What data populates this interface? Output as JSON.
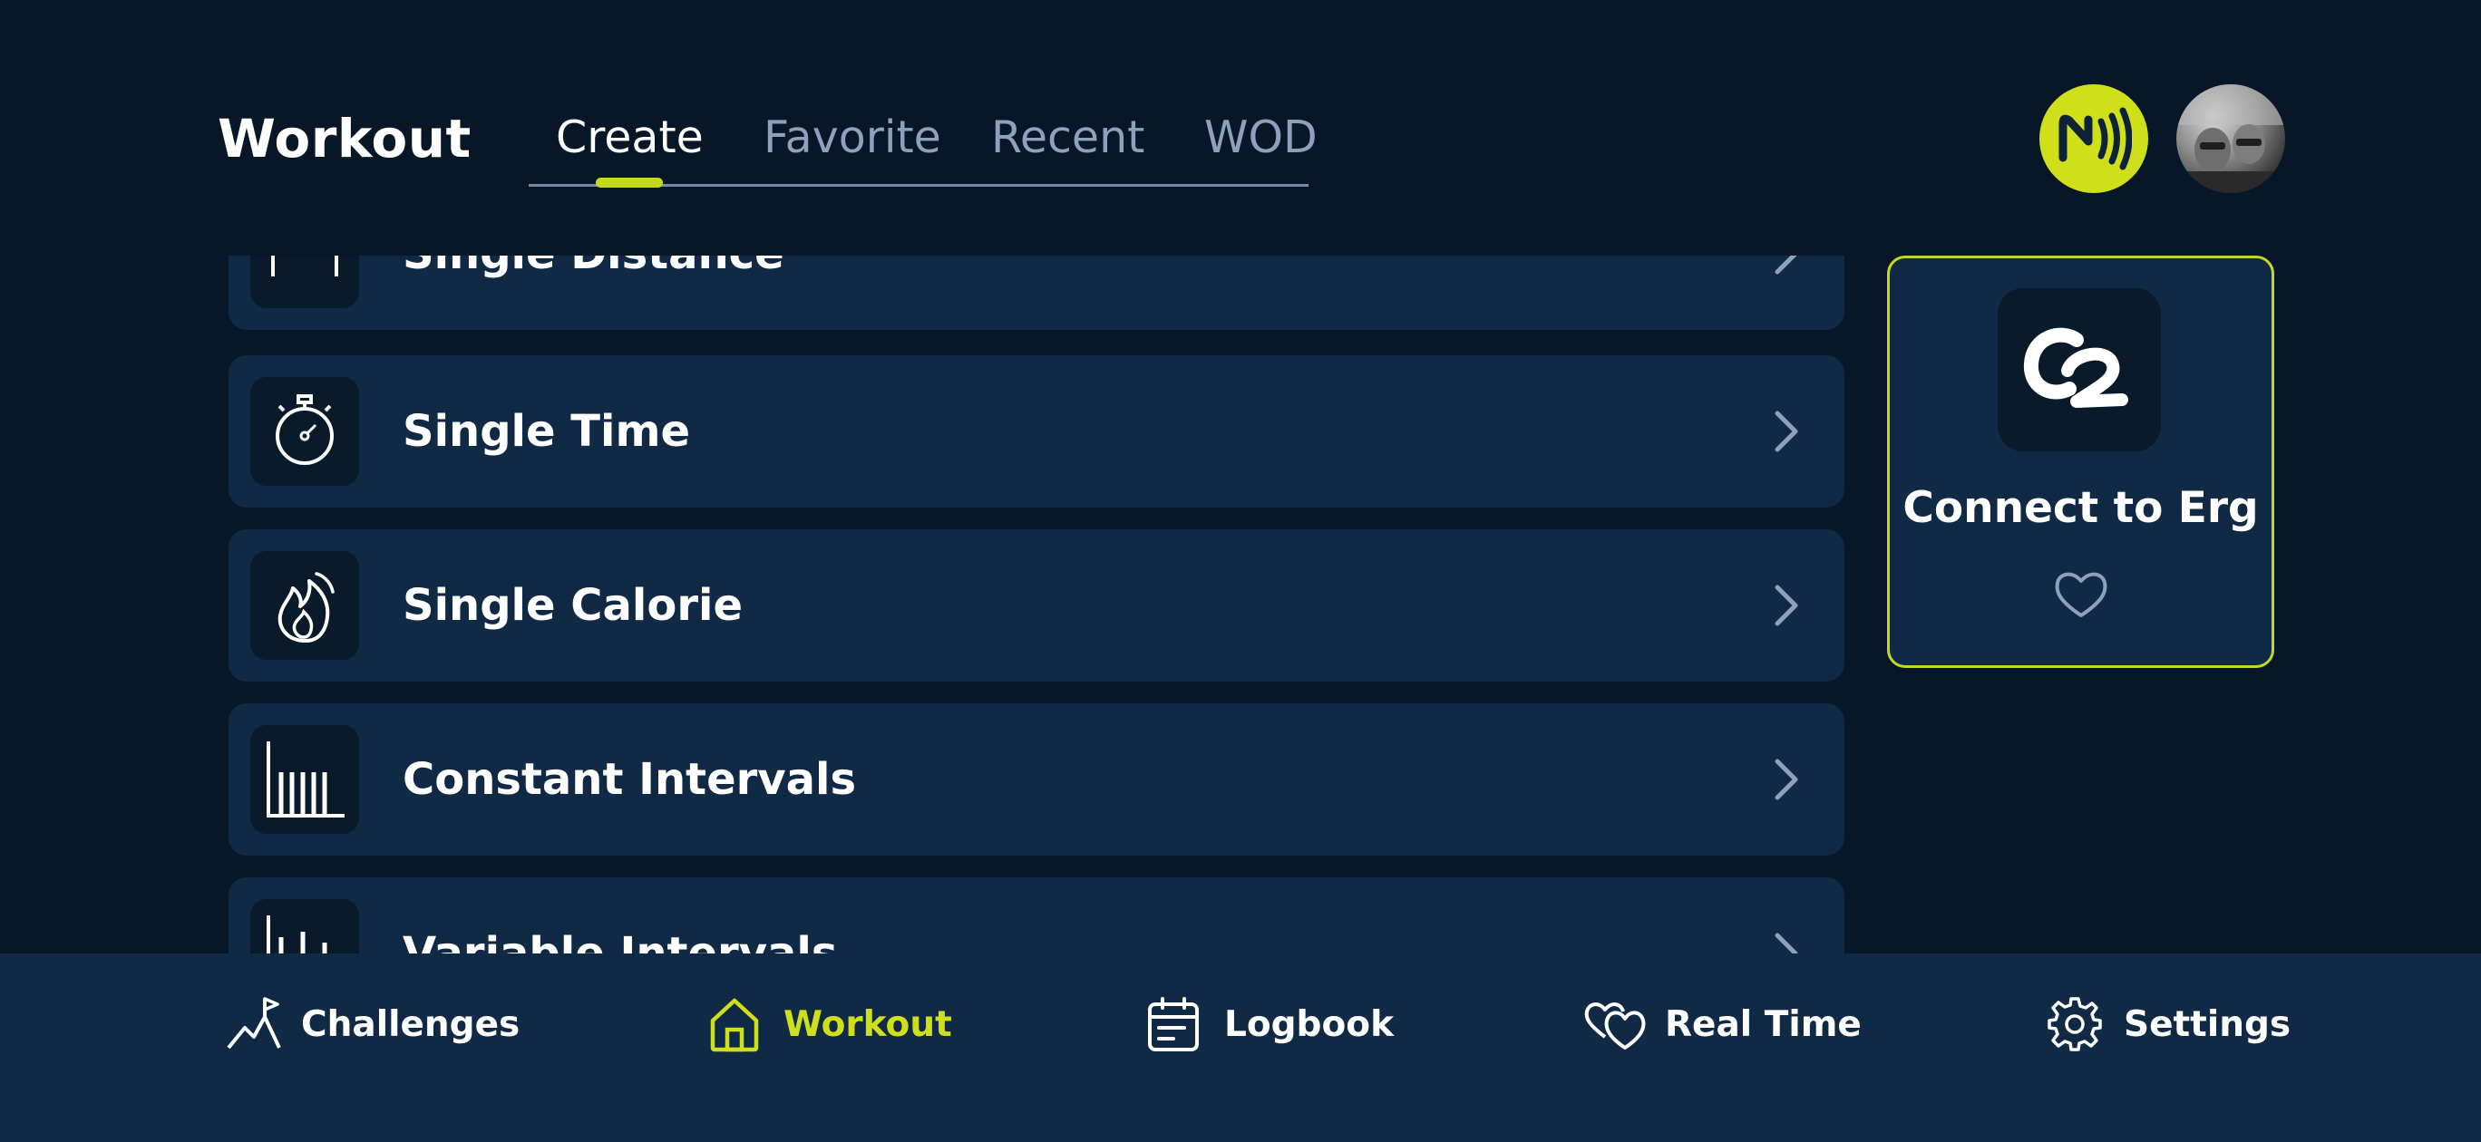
{
  "header": {
    "title": "Workout",
    "tabs": [
      {
        "label": "Create",
        "active": true
      },
      {
        "label": "Favorite",
        "active": false
      },
      {
        "label": "Recent",
        "active": false
      },
      {
        "label": "WOD",
        "active": false
      }
    ],
    "nfc_icon": "nfc-icon",
    "accent_color": "#cfe01a"
  },
  "workout_list": {
    "items": [
      {
        "label": "Single Distance",
        "icon": "distance-arrow-icon"
      },
      {
        "label": "Single Time",
        "icon": "stopwatch-icon"
      },
      {
        "label": "Single Calorie",
        "icon": "flame-icon"
      },
      {
        "label": "Constant Intervals",
        "icon": "constant-bars-icon"
      },
      {
        "label": "Variable Intervals",
        "icon": "variable-bars-icon"
      }
    ]
  },
  "connect_card": {
    "label": "Connect to Erg",
    "logo_icon": "c2-logo",
    "favorite_icon": "heart-icon"
  },
  "bottom_nav": {
    "items": [
      {
        "label": "Challenges",
        "icon": "flag-mountain-icon",
        "active": false
      },
      {
        "label": "Workout",
        "icon": "home-icon",
        "active": true
      },
      {
        "label": "Logbook",
        "icon": "calendar-icon",
        "active": false
      },
      {
        "label": "Real Time",
        "icon": "hearts-icon",
        "active": false
      },
      {
        "label": "Settings",
        "icon": "gear-icon",
        "active": false
      }
    ]
  },
  "colors": {
    "background": "#081727",
    "card": "#102944",
    "accent": "#cfe01a",
    "inactive_text": "#8ea1bb"
  }
}
